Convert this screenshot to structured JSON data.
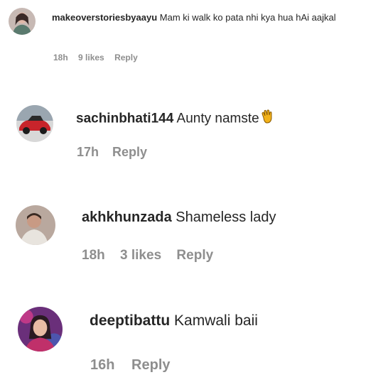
{
  "comments": [
    {
      "username": "makeoverstoriesbyaayu",
      "text": "Mam ki walk ko pata nhi kya hua hAi aajkal",
      "time": "18h",
      "likes": "9 likes",
      "reply": "Reply",
      "avatar_icon": "profile-photo"
    },
    {
      "username": "sachinbhati144",
      "text": "Aunty namste",
      "emoji": "clapping-hands-icon",
      "time": "17h",
      "reply": "Reply",
      "avatar_icon": "red-car-photo"
    },
    {
      "username": "akhkhunzada",
      "text": "Shameless lady",
      "time": "18h",
      "likes": "3 likes",
      "reply": "Reply",
      "avatar_icon": "profile-photo"
    },
    {
      "username": "deeptibattu",
      "text": "Kamwali baii",
      "time": "16h",
      "reply": "Reply",
      "avatar_icon": "profile-photo"
    }
  ],
  "colors": {
    "primary_text": "#262626",
    "secondary_text": "#8e8e8e",
    "emoji": "#f2b21a"
  }
}
